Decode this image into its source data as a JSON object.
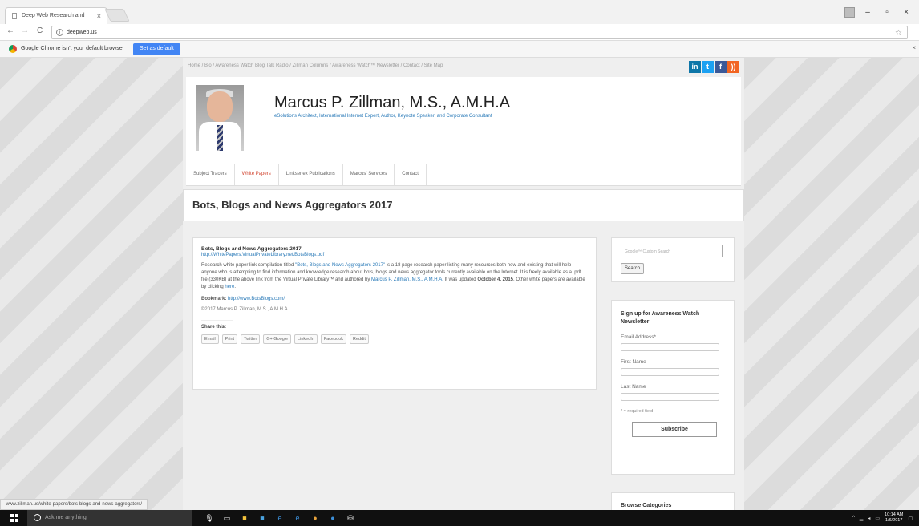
{
  "browser": {
    "tab_title": "Deep Web Research and",
    "tab_close": "×",
    "url": "deepweb.us",
    "info_icon": "i",
    "back": "←",
    "forward": "→",
    "reload": "C",
    "bookmark_star": "☆",
    "window_controls": {
      "minimize": "–",
      "maximize": "▫",
      "close": "×"
    },
    "infobar": {
      "message": "Google Chrome isn't your default browser",
      "button": "Set as default",
      "close": "×"
    },
    "status_url": "www.zillman.us/white-papers/bots-blogs-and-news-aggregators/"
  },
  "site": {
    "top_nav": "Home / Bio / Awareness Watch Blog Talk Radio / Zillman Columns / Awareness Watch™ Newsletter / Contact / Site Map",
    "social": {
      "linkedin": "in",
      "twitter": "t",
      "facebook": "f",
      "rss": "))"
    },
    "name": "Marcus P. Zillman, M.S., A.M.H.A",
    "tagline": "eSolutions Architect, International Internet Expert, Author, Keynote Speaker, and Corporate Consultant",
    "nav": [
      "Subject Tracers",
      "White Papers",
      "Linksenex Publications",
      "Marcus' Services",
      "Contact"
    ],
    "page_title": "Bots, Blogs and News Aggregators 2017"
  },
  "article": {
    "title": "Bots, Blogs and News Aggregators 2017",
    "url": "http://WhitePapers.VirtualPrivateLibrary.net/BotsBlogs.pdf",
    "para_pre": "Research white paper link compilation titled ",
    "para_link": "\"Bots, Blogs and News Aggregators 2017\"",
    "para_mid": " is a 18 page research paper listing many resources both new and existing that will help anyone who is attempting to find information and knowledge research about bots, blogs and news aggregator tools currently available on the Internet. It is freely available as a .pdf file (330KB) at the above link from the Virtual Private Library™ and authored by ",
    "para_author": "Marcus P. Zillman, M.S., A.M.H.A.",
    "para_updated_pre": " It was updated ",
    "para_date": "October 4, 2015",
    "para_end": ". Other white papers are available by clicking ",
    "para_here": "here",
    "bookmark_label": "Bookmark:",
    "bookmark_url": "http://www.BotsBlogs.com/",
    "copyright": "©2017 Marcus P. Zillman, M.S., A.M.H.A.",
    "share_label": "Share this:",
    "share_buttons": [
      "Email",
      "Print",
      "Twitter",
      "G+ Google",
      "LinkedIn",
      "Facebook",
      "Reddit"
    ]
  },
  "sidebar": {
    "search_placeholder": "Google™ Custom Search",
    "search_button": "Search",
    "newsletter_heading": "Sign up for Awareness Watch Newsletter",
    "email_label": "Email Address*",
    "first_name_label": "First Name",
    "last_name_label": "Last Name",
    "required_note": "* = required field",
    "subscribe_button": "Subscribe",
    "browse_heading": "Browse Categories"
  },
  "taskbar": {
    "search_placeholder": "Ask me anything",
    "time": "10:14 AM",
    "date": "1/6/2017"
  }
}
